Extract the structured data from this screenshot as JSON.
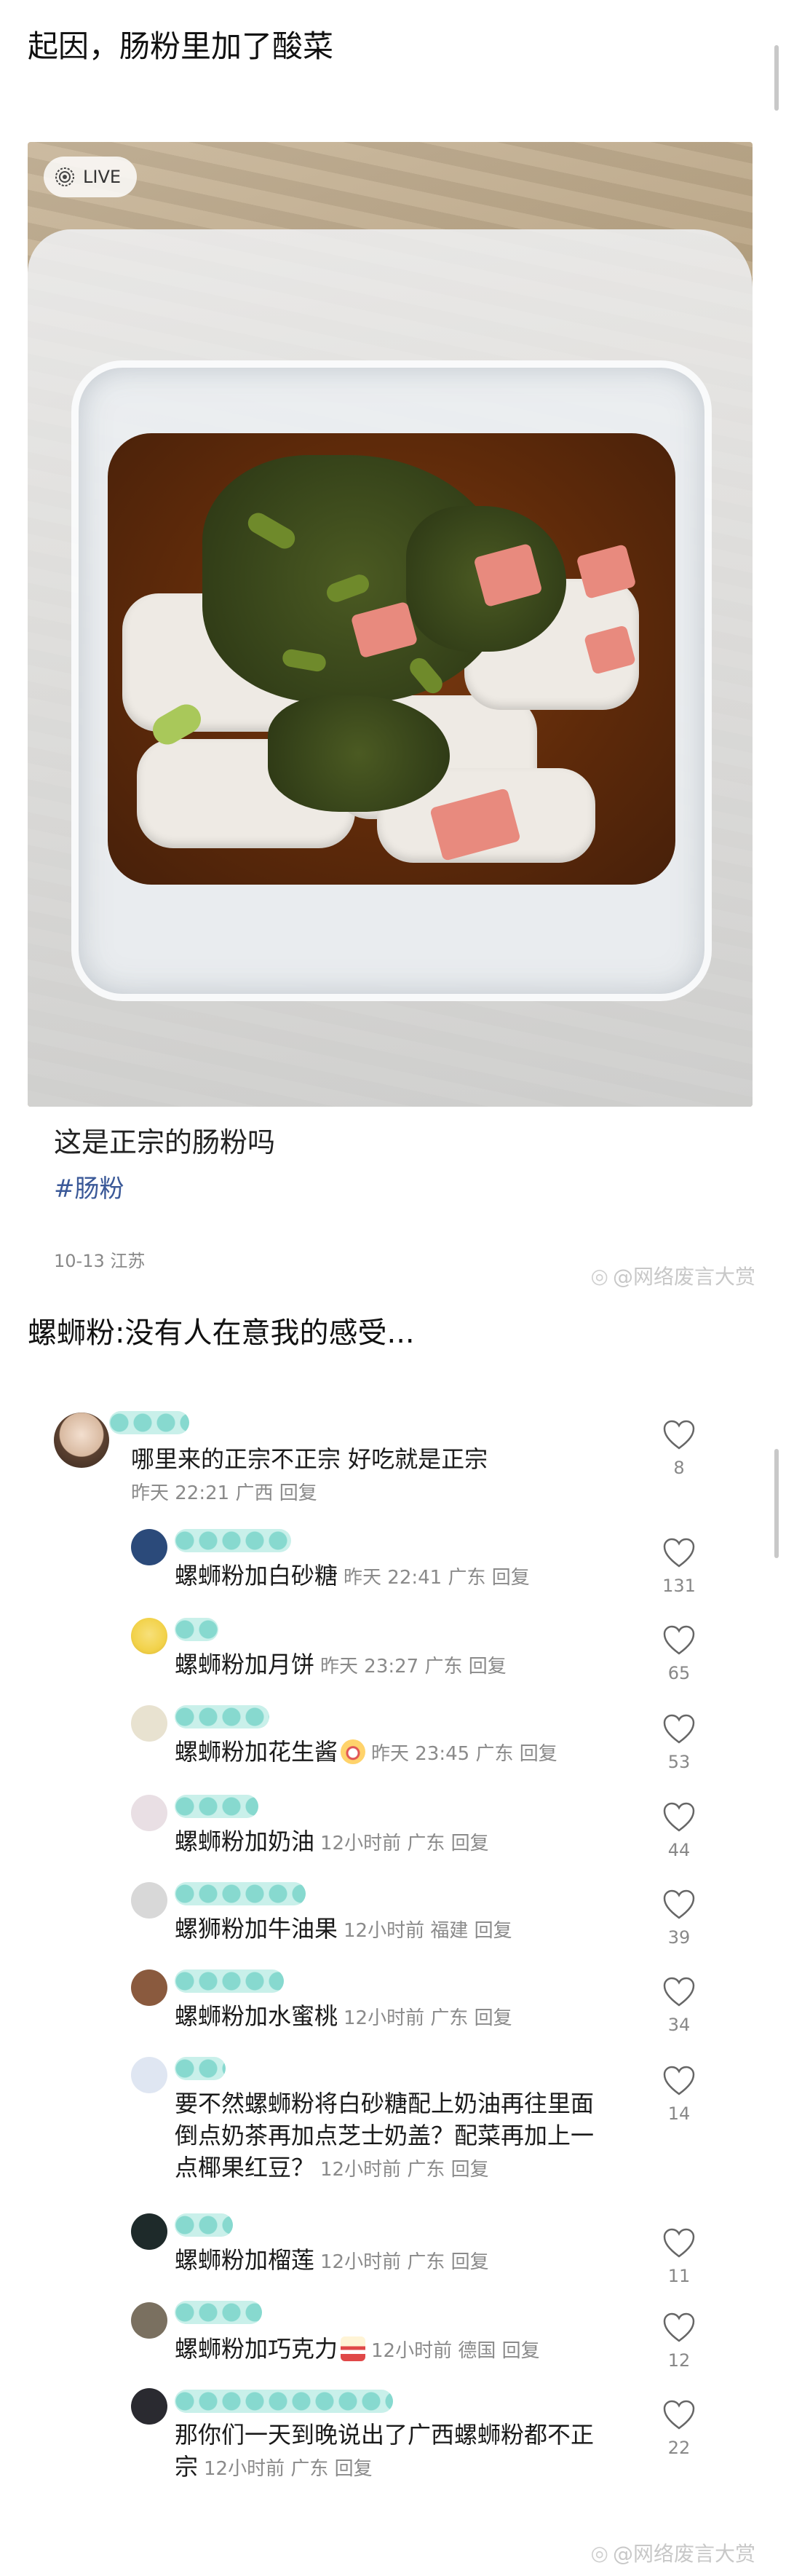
{
  "post": {
    "title": "起因，肠粉里加了酸菜",
    "live_label": "LIVE",
    "caption": "这是正宗的肠粉吗",
    "hashtag": "#肠粉",
    "meta": "10-13 江苏",
    "watermark": "@网络废言大赏"
  },
  "section_title": "螺蛳粉:没有人在意我的感受...",
  "comments": {
    "main": {
      "text": "哪里来的正宗不正宗 好吃就是正宗",
      "meta": "昨天 22:21 广西 回复",
      "likes": "8"
    },
    "replies": [
      {
        "text": "螺蛳粉加白砂糖",
        "meta": "昨天 22:41 广东 回复",
        "likes": "131",
        "avatar_color": "#2b4a7a"
      },
      {
        "text": "螺蛳粉加月饼",
        "meta": "昨天 23:27 广东 回复",
        "likes": "65",
        "avatar_color": "#f2d24a"
      },
      {
        "text": "螺蛳粉加花生酱",
        "meta": "昨天 23:45 广东 回复",
        "likes": "53",
        "avatar_color": "#e8e2d0"
      },
      {
        "text": "螺蛳粉加奶油",
        "meta": "12小时前 广东 回复",
        "likes": "44",
        "avatar_color": "#e9dfe4"
      },
      {
        "text": "螺狮粉加牛油果",
        "meta": "12小时前 福建 回复",
        "likes": "39",
        "avatar_color": "#d8d8d8"
      },
      {
        "text": "螺蛳粉加水蜜桃",
        "meta": "12小时前 广东 回复",
        "likes": "34",
        "avatar_color": "#8a5a3e"
      },
      {
        "text_lines": [
          "要不然螺蛳粉将白砂糖配上奶油再往里面",
          "倒点奶茶再加点芝士奶盖？配菜再加上一",
          "点椰果红豆？"
        ],
        "meta": "12小时前 广东 回复",
        "likes": "14",
        "avatar_color": "#dfe6f2"
      },
      {
        "text": "螺蛳粉加榴莲",
        "meta": "12小时前 广东 回复",
        "likes": "11",
        "avatar_color": "#1e2a2a"
      },
      {
        "text": "螺蛳粉加巧克力",
        "meta": "12小时前 德国 回复",
        "likes": "12",
        "avatar_color": "#7a7060"
      },
      {
        "text_lines": [
          "那你们一天到晚说出了广西螺蛳粉都不正",
          "宗"
        ],
        "meta": "12小时前 广东 回复",
        "likes": "22",
        "avatar_color": "#2a2a30"
      }
    ]
  },
  "icons": {
    "like": "heart-outline-icon",
    "live": "live-photo-icon",
    "watermark": "weibo-icon"
  }
}
